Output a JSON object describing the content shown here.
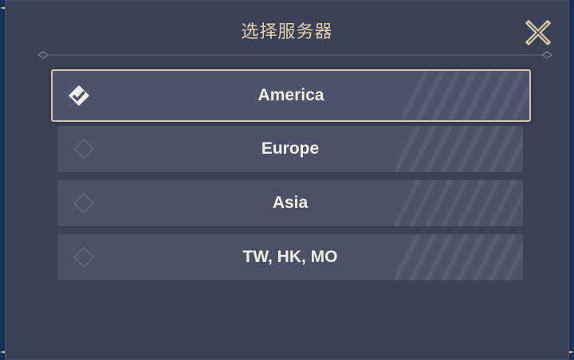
{
  "dialog": {
    "title": "选择服务器",
    "close_icon": "close-icon"
  },
  "servers": [
    {
      "label": "America",
      "selected": true
    },
    {
      "label": "Europe",
      "selected": false
    },
    {
      "label": "Asia",
      "selected": false
    },
    {
      "label": "TW, HK, MO",
      "selected": false
    }
  ],
  "colors": {
    "dialog_bg": "#3a4258",
    "option_bg": "#4a5268",
    "accent_gold": "#e6cf9f",
    "selected_border": "#d9c79f",
    "text": "#f2eee6"
  }
}
